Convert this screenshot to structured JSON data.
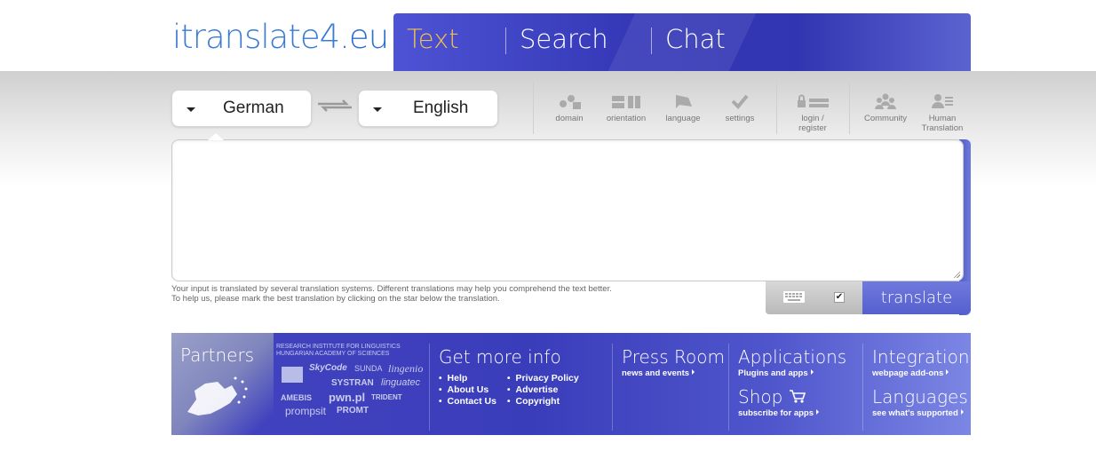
{
  "header": {
    "logo_main": "itranslate4",
    "logo_suffix": ".eu",
    "tabs": [
      {
        "label": "Text",
        "active": true
      },
      {
        "label": "Search",
        "active": false
      },
      {
        "label": "Chat",
        "active": false
      }
    ]
  },
  "toolbar": {
    "source_language": "German",
    "target_language": "English",
    "items": {
      "domain": "domain",
      "orientation": "orientation",
      "language": "language",
      "settings": "settings",
      "login_line1": "login /",
      "login_line2": "register",
      "community": "Community",
      "human_line1": "Human",
      "human_line2": "Translation"
    }
  },
  "input": {
    "value": "",
    "placeholder": ""
  },
  "note": {
    "line1": "Your input is translated by several translation systems. Different translations may help you comprehend the text better.",
    "line2": "To help us, please mark the best translation by clicking on the star below the translation."
  },
  "actions": {
    "checkbox_checked": true,
    "translate_label": "translate"
  },
  "footer": {
    "partners_title": "Partners",
    "partner_logos": {
      "research_line1": "RESEARCH INSTITUTE FOR LINGUISTICS",
      "research_line2": "HUNGARIAN ACADEMY OF SCIENCES",
      "skycode": "SkyCode",
      "sunda": "SUNDA",
      "lingenio": "lingenio",
      "systran": "SYSTRAN",
      "linguatec": "linguatec",
      "amebis": "AMEBIS",
      "pwn": "pwn.pl",
      "trident": "TRIDENT",
      "prompsit": "prompsit",
      "promt": "PROMT"
    },
    "more_info": {
      "title": "Get more info",
      "col1": [
        "Help",
        "About Us",
        "Contact Us"
      ],
      "col2": [
        "Privacy Policy",
        "Advertise",
        "Copyright"
      ]
    },
    "press": {
      "title": "Press Room",
      "sub": "news and events"
    },
    "applications": {
      "title": "Applications",
      "sub": "Plugins and apps"
    },
    "shop": {
      "title": "Shop",
      "sub": "subscribe for apps"
    },
    "integration": {
      "title": "Integration",
      "sub": "webpage add-ons"
    },
    "languages": {
      "title": "Languages",
      "sub": "see what's supported"
    }
  },
  "colors": {
    "accent_blue": "#3539b7",
    "active_tab": "#f0c24b",
    "logo_blue": "#3a7bd5"
  }
}
